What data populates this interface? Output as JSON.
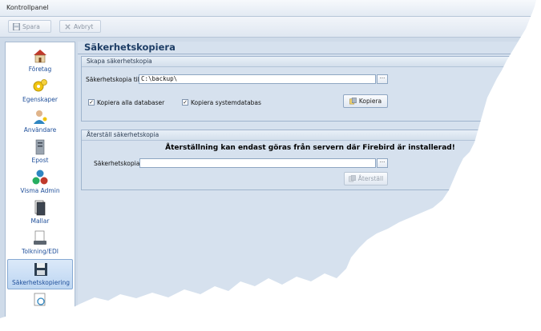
{
  "window": {
    "title": "Kontrollpanel"
  },
  "toolbar": {
    "save_label": "Spara",
    "cancel_label": "Avbryt"
  },
  "sidebar": {
    "items": [
      {
        "label": "Företag",
        "icon": "house-icon"
      },
      {
        "label": "Egenskaper",
        "icon": "gears-icon"
      },
      {
        "label": "Användare",
        "icon": "user-icon"
      },
      {
        "label": "Epost",
        "icon": "server-icon"
      },
      {
        "label": "Visma Admin",
        "icon": "currency-icon"
      },
      {
        "label": "Mallar",
        "icon": "template-icon"
      },
      {
        "label": "Tolkning/EDI",
        "icon": "scanner-icon"
      },
      {
        "label": "Säkerhetskopiering",
        "icon": "floppy-icon",
        "active": true
      }
    ]
  },
  "main": {
    "title": "Säkerhetskopiera",
    "backup": {
      "header": "Skapa säkerhetskopia",
      "target_label": "Säkerhetskopia till:",
      "target_value": "C:\\backup\\",
      "browse_label": "···",
      "copy_all_label": "Kopiera alla databaser",
      "copy_all_checked": true,
      "copy_system_label": "Kopiera systemdatabas",
      "copy_system_checked": true,
      "copy_button": "Kopiera"
    },
    "restore": {
      "header": "Återställ säkerhetskopia",
      "notice": "Återställning kan endast göras från servern där Firebird är installerad!",
      "file_label": "Säkerhetskopia:",
      "file_value": "",
      "browse_label": "···",
      "restore_button": "Återställ"
    }
  },
  "colors": {
    "accent": "#1f4f9a",
    "panel": "#d6e1ee",
    "border": "#9fb4cd"
  }
}
